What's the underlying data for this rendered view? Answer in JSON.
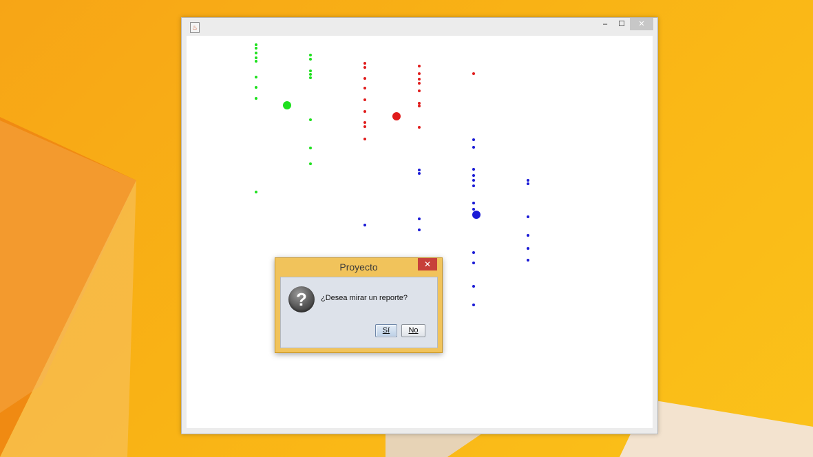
{
  "desktop": {
    "colors": {
      "wallpaper_base": "#f9b315",
      "wallpaper_shadow": "#f08a12",
      "floor": "#f3e3cf"
    }
  },
  "main_window": {
    "title": "",
    "controls": {
      "minimize": "–",
      "maximize": "☐",
      "close": "✕"
    },
    "icon": "java-cup-icon",
    "canvas": {
      "background": "#ffffff",
      "series_colors": {
        "green": "#1ee01e",
        "red": "#e01b1b",
        "blue": "#1a1ad6"
      }
    }
  },
  "dialog": {
    "title": "Proyecto",
    "close": "✕",
    "icon": "question-icon",
    "icon_glyph": "?",
    "message": "¿Desea mirar un reporte?",
    "yes_label": "Sí",
    "no_label": "No"
  }
}
